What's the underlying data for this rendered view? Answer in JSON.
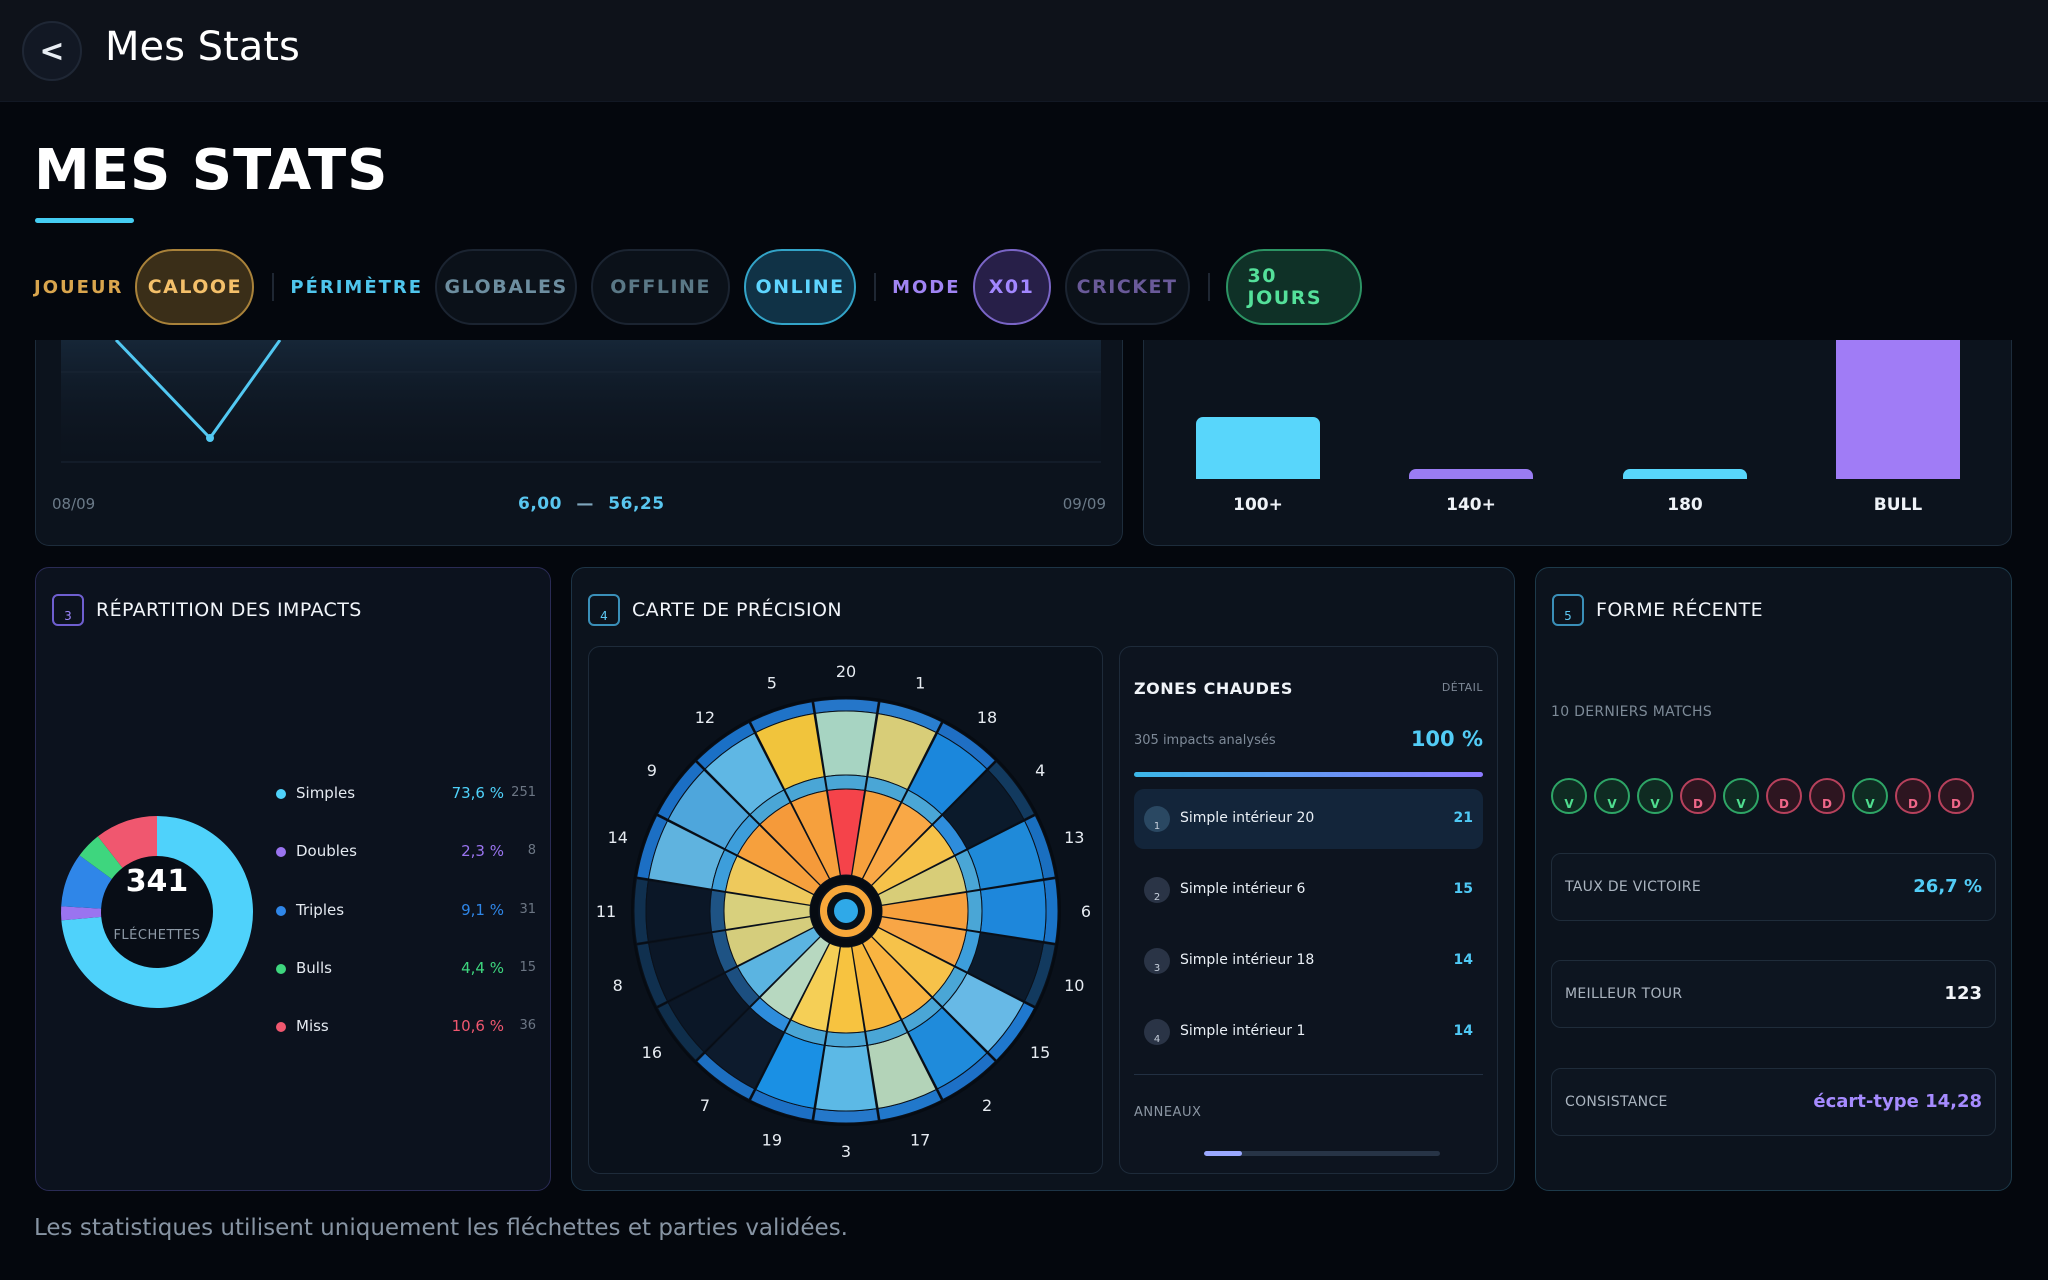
{
  "topbar": {
    "back_glyph": "<",
    "title": "Mes Stats"
  },
  "header": {
    "title": "MES STATS"
  },
  "filters": {
    "joueur_label": "JOUEUR",
    "joueur_value": "CALOOE",
    "perimetre_label": "PÉRIMÈTRE",
    "perimetre_options": [
      "GLOBALES",
      "OFFLINE",
      "ONLINE"
    ],
    "perimetre_selected": "ONLINE",
    "mode_label": "MODE",
    "mode_options": [
      "X01",
      "CRICKET"
    ],
    "mode_selected": "X01",
    "period": "30 JOURS"
  },
  "evolution": {
    "date_start": "08/09",
    "range_min": "6,00",
    "range_dash": "—",
    "range_max": "56,25",
    "date_end": "09/09"
  },
  "score_bars": {
    "items": [
      {
        "label": "100+",
        "color": "#58d6fb"
      },
      {
        "label": "140+",
        "color": "#9a7cf2"
      },
      {
        "label": "180",
        "color": "#58d6fb"
      },
      {
        "label": "BULL",
        "color": "#a07cf6"
      }
    ]
  },
  "repartition": {
    "badge": "3",
    "title": "RÉPARTITION DES IMPACTS",
    "total": "341",
    "total_label": "FLÉCHETTES",
    "items": [
      {
        "name": "Simples",
        "pct": "73,6 %",
        "count": "251",
        "color": "#4fd2fb"
      },
      {
        "name": "Doubles",
        "pct": "2,3 %",
        "count": "8",
        "color": "#9a74f0"
      },
      {
        "name": "Triples",
        "pct": "9,1 %",
        "count": "31",
        "color": "#2f86e8"
      },
      {
        "name": "Bulls",
        "pct": "4,4 %",
        "count": "15",
        "color": "#3ed67e"
      },
      {
        "name": "Miss",
        "pct": "10,6 %",
        "count": "36",
        "color": "#f0576f"
      }
    ]
  },
  "precision": {
    "badge": "4",
    "title": "CARTE DE PRÉCISION",
    "board_numbers": [
      "20",
      "1",
      "18",
      "4",
      "13",
      "6",
      "10",
      "15",
      "2",
      "17",
      "3",
      "19",
      "7",
      "16",
      "8",
      "11",
      "14",
      "9",
      "12",
      "5"
    ],
    "zones_title": "ZONES CHAUDES",
    "zones_detail": "DÉTAIL",
    "zones_sub": "305 impacts analysés",
    "zones_pct": "100 %",
    "zones": [
      {
        "idx": "1",
        "name": "Simple intérieur 20",
        "value": "21"
      },
      {
        "idx": "2",
        "name": "Simple intérieur 6",
        "value": "15"
      },
      {
        "idx": "3",
        "name": "Simple intérieur 18",
        "value": "14"
      },
      {
        "idx": "4",
        "name": "Simple intérieur 1",
        "value": "14"
      }
    ],
    "rings_label": "ANNEAUX",
    "rings_progress": 0.16
  },
  "forme": {
    "badge": "5",
    "title": "FORME RÉCENTE",
    "sub": "10 DERNIERS MATCHS",
    "results": [
      "V",
      "V",
      "V",
      "D",
      "V",
      "D",
      "D",
      "V",
      "D",
      "D"
    ],
    "stats": [
      {
        "label": "TAUX DE VICTOIRE",
        "value": "26,7 %",
        "color": "#52ccf6"
      },
      {
        "label": "MEILLEUR TOUR",
        "value": "123",
        "color": "#f2f5f9"
      },
      {
        "label": "CONSISTANCE",
        "value": "écart-type 14,28",
        "color": "#a68bff"
      }
    ]
  },
  "footer": "Les statistiques utilisent uniquement les fléchettes et parties validées."
}
